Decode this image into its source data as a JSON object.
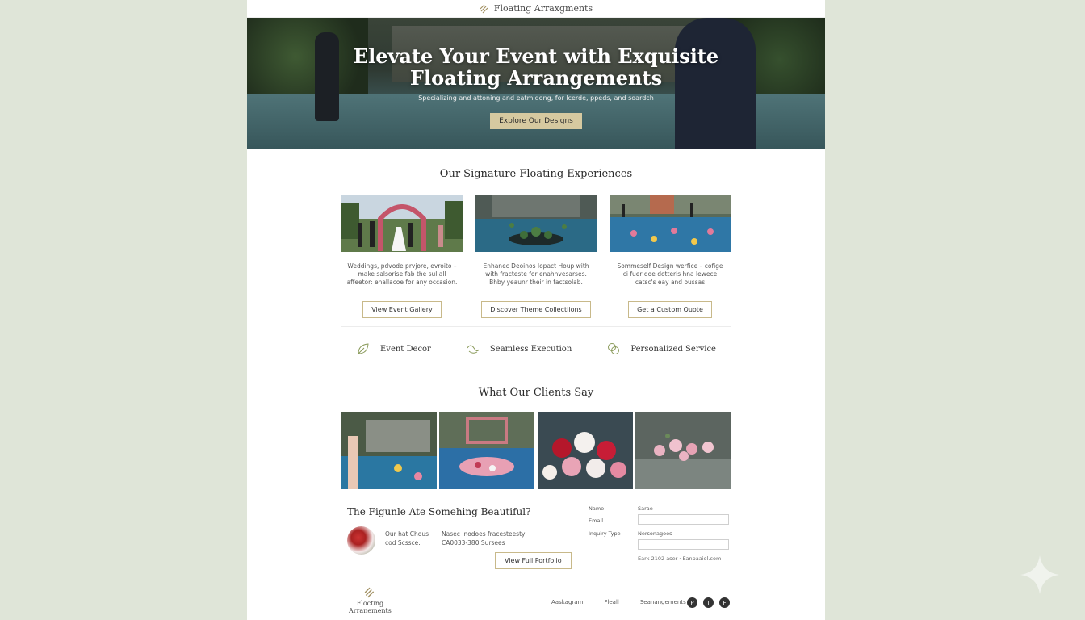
{
  "header": {
    "brand": "Floating Arraxgments"
  },
  "hero": {
    "title_line1": "Elevate Your Event with Exquisite",
    "title_line2": "Floating Arrangements",
    "subtitle": "Specializing and attoning and eatmldong, for lcerde, ppeds, and soardch",
    "button": "Explore Our Designs"
  },
  "signature": {
    "title": "Our Signature Floating Experiences",
    "cards": [
      {
        "text": "Weddings, pdvode prvjore, evroito – make salsorise fab the sul all affeetor: enallacoe for any occasion.",
        "button": "View Event Gallery"
      },
      {
        "text": "Enhanec Deoinos Iopact Houp with with fracteste for enahnvesarses. Bhby yeaunr their in factsolab.",
        "button": "Discover Theme Collectiions"
      },
      {
        "text": "Sommeself Design werfice – cofige ci fuer doe dotteris hna lewece catsc's eay and oussas",
        "button": "Get a Custom Quote"
      }
    ]
  },
  "features": [
    {
      "label": "Event Decor",
      "icon": "leaf-icon"
    },
    {
      "label": "Seamless Execution",
      "icon": "petal-icon"
    },
    {
      "label": "Personalized Service",
      "icon": "interlock-icon"
    }
  ],
  "clients": {
    "title": "What Our Clients Say"
  },
  "cta": {
    "title": "The Figunle Ate Somehing Beautiful?",
    "contact_a_line1": "Our hat Chous",
    "contact_a_line2": "cod Scssce.",
    "contact_b_line1": "Nasec Inodoes fracesteesty",
    "contact_b_line2": "CA0033-380  Sursees",
    "button": "View Full Portfolio"
  },
  "form": {
    "name_label": "Name",
    "name_field_label": "Sarae",
    "email_label": "Email",
    "inquiry_label": "Inquiry Type",
    "inquiry_field_label": "Nersonagoes",
    "note": "Eark 2102 aser  ·  Eanpaaiel.com"
  },
  "footer": {
    "logo_line1": "Flocting",
    "logo_line2": "Arranements",
    "links": [
      "Aaskagram",
      "Fleall",
      "Seanangements"
    ],
    "social": [
      "P",
      "T",
      "F"
    ]
  }
}
